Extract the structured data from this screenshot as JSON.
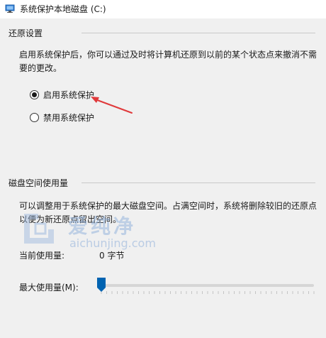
{
  "window": {
    "title": "系统保护本地磁盘 (C:)",
    "icon": "system-properties-icon"
  },
  "restore_settings": {
    "group_title": "还原设置",
    "description_line1": "启用系统保护后，你可以通过及时将计算机还原到以前的某个状态点来撤消不需",
    "description_line2": "要的更改。",
    "options": [
      {
        "label": "启用系统保护",
        "selected": true
      },
      {
        "label": "禁用系统保护",
        "selected": false
      }
    ],
    "annotation_arrow_color": "#e0393b"
  },
  "disk_usage": {
    "group_title": "磁盘空间使用量",
    "description_line1": "可以调整用于系统保护的最大磁盘空间。占满空间时，系统将删除较旧的还原点",
    "description_line2": "以便为新还原点留出空间。",
    "current_usage_label": "当前使用量:",
    "current_usage_value": "0 字节",
    "max_usage_label": "最大使用量(M):",
    "max_usage_fraction": 0
  },
  "watermark": {
    "text_cn": "爱纯净",
    "url": "aichunjing.com"
  },
  "colors": {
    "accent": "#0063b1",
    "panel_bg": "#f0f0f0"
  }
}
